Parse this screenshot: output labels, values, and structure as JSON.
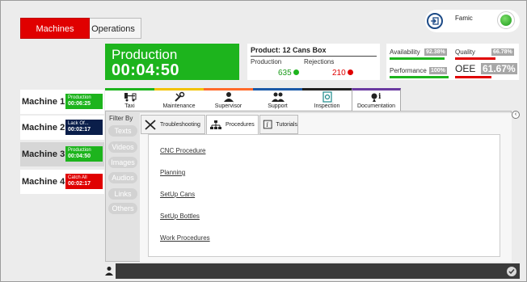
{
  "nav": {
    "machines_tab": "Machines",
    "operations_tab": "Operations",
    "user_name": "Famic"
  },
  "production": {
    "state_label": "Production",
    "elapsed": "00:04:50"
  },
  "product": {
    "title": "Product: 12 Cans Box",
    "production_label": "Production",
    "rejections_label": "Rejections",
    "production_count": "635",
    "rejections_count": "210"
  },
  "kpi": {
    "availability_label": "Availability",
    "availability_value": "92.38%",
    "quality_label": "Quality",
    "quality_value": "66.78%",
    "performance_label": "Performance",
    "performance_value": "100%",
    "oee_label": "OEE",
    "oee_value": "61.67%"
  },
  "machines": [
    {
      "name": "Machine 1",
      "state": "Production",
      "time": "00:06:25",
      "color": "#1db41d"
    },
    {
      "name": "Machine 2",
      "state": "Lack Of...",
      "time": "00:02:17",
      "color": "#0a1e4a"
    },
    {
      "name": "Machine 3",
      "state": "Production",
      "time": "00:04:50",
      "color": "#1db41d"
    },
    {
      "name": "Machine 4",
      "state": "Catch All",
      "time": "00:02:17",
      "color": "#e00000"
    }
  ],
  "function_tabs": [
    {
      "label": "Taxi",
      "icon": "taxi-icon",
      "color": "#1db41d"
    },
    {
      "label": "Maintenance",
      "icon": "wrench-icon",
      "color": "#f2c200"
    },
    {
      "label": "Supervisor",
      "icon": "supervisor-icon",
      "color": "#ff6a2a"
    },
    {
      "label": "Support",
      "icon": "support-icon",
      "color": "#1c5aa8"
    },
    {
      "label": "Inspection",
      "icon": "inspection-icon",
      "color": "#222222"
    },
    {
      "label": "Documentation",
      "icon": "documentation-icon",
      "color": "#6a3aa0"
    }
  ],
  "filter": {
    "title": "Filter By",
    "options": [
      "Texts",
      "Videos",
      "Images",
      "Audios",
      "Links",
      "Others"
    ]
  },
  "doc_tabs": [
    {
      "label": "Troubleshooting",
      "icon": "tools-icon"
    },
    {
      "label": "Procedures",
      "icon": "hierarchy-icon"
    },
    {
      "label": "Tutorials",
      "icon": "info-icon"
    }
  ],
  "procedures": [
    "CNC Procedure",
    "Planning",
    "SetUp Cans",
    "SetUp Bottles",
    "Work Procedures"
  ]
}
